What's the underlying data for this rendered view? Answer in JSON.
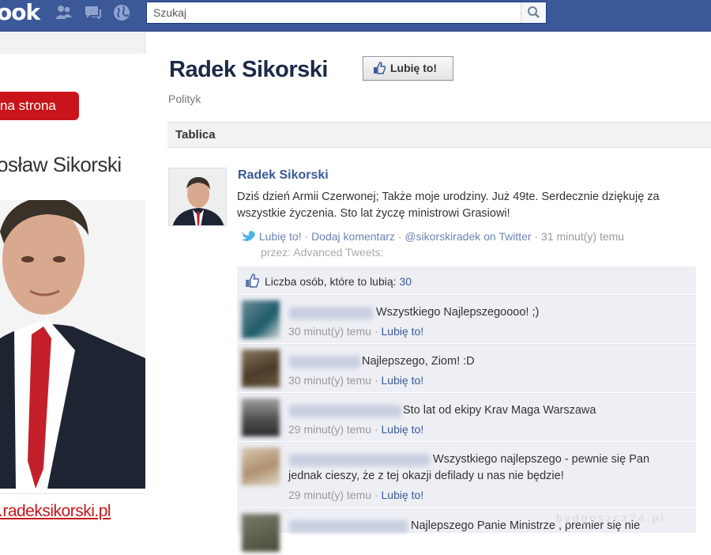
{
  "topbar": {
    "logo_text": "ook",
    "search": {
      "placeholder": "Szukaj",
      "value": ""
    },
    "icons": [
      "friend-requests-icon",
      "messages-icon",
      "notifications-globe-icon",
      "search-icon"
    ]
  },
  "banner": {
    "button_label": "na strona",
    "name": "osław Sikorski",
    "url": ".radeksikorski.pl"
  },
  "page": {
    "title": "Radek Sikorski",
    "like_button": "Lubię to!",
    "category": "Polityk",
    "tab": "Tablica"
  },
  "post": {
    "author": "Radek Sikorski",
    "text": "Dziś dzień Armii Czerwonej; Także moje urodziny. Już 49te. Serdecznie dziękuję za wszystkie życzenia. Sto lat życzę ministrowi Grasiowi!",
    "actions": {
      "like": "Lubię to!",
      "comment": "Dodaj komentarz",
      "twitter": "@sikorskiradek on Twitter",
      "time": "31 minut(y) temu",
      "via": "przez: Advanced Tweets:"
    },
    "likes_text": "Liczba osób, które to lubią:",
    "likes_count": "30"
  },
  "comments": [
    {
      "text": "Wszystkiego Najlepszegoooo! ;)",
      "time": "30 minut(y) temu",
      "like": "Lubię to!"
    },
    {
      "text": "Najlepszego, Ziom! :D",
      "time": "30 minut(y) temu",
      "like": "Lubię to!"
    },
    {
      "text": "Sto lat od ekipy Krav Maga Warszawa",
      "time": "29 minut(y) temu",
      "like": "Lubię to!"
    },
    {
      "text_line1": "Wszystkiego najlepszego - pewnie się Pan",
      "text_line2": "jednak cieszy, że z tej okazji defilady u nas nie będzie!",
      "time": "29 minut(y) temu",
      "like": "Lubię to!"
    },
    {
      "text": "Najlepszego Panie Ministrze , premier się nie"
    }
  ],
  "separator": "·",
  "watermark": "bydgoszcz24.pl",
  "colors": {
    "facebook_blue": "#3b5998",
    "link": "#3b5998",
    "banner_red": "#c8141a",
    "comment_bg": "#edeff4"
  }
}
